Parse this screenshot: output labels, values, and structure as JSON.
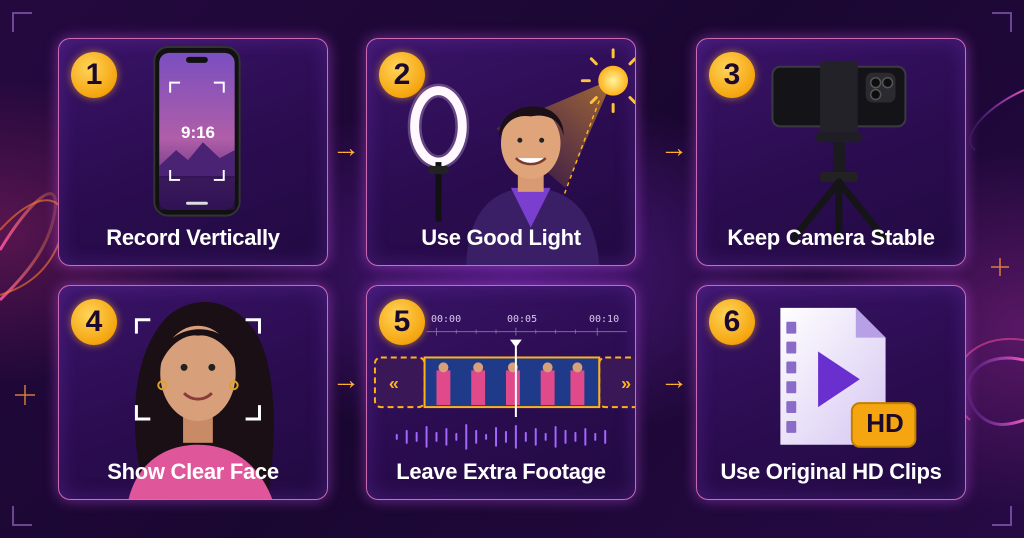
{
  "steps": [
    {
      "number": "1",
      "label": "Record Vertically"
    },
    {
      "number": "2",
      "label": "Use Good Light"
    },
    {
      "number": "3",
      "label": "Keep Camera Stable"
    },
    {
      "number": "4",
      "label": "Show Clear Face"
    },
    {
      "number": "5",
      "label": "Leave Extra Footage"
    },
    {
      "number": "6",
      "label": "Use Original HD Clips"
    }
  ],
  "phone_aspect": "9:16",
  "timeline": {
    "ticks": [
      "00:00",
      "00:05",
      "00:10"
    ]
  },
  "hd_badge": "HD",
  "arrows": [
    "→",
    "→",
    "→",
    "→"
  ],
  "colors": {
    "accent": "#f5a50f",
    "card_border": "#ff8cd2",
    "background": "#1c0933"
  },
  "icons": [
    "phone-icon",
    "ring-light-icon",
    "sun-icon",
    "tripod-icon",
    "face-frame-icon",
    "video-timeline-icon",
    "hd-video-file-icon"
  ]
}
